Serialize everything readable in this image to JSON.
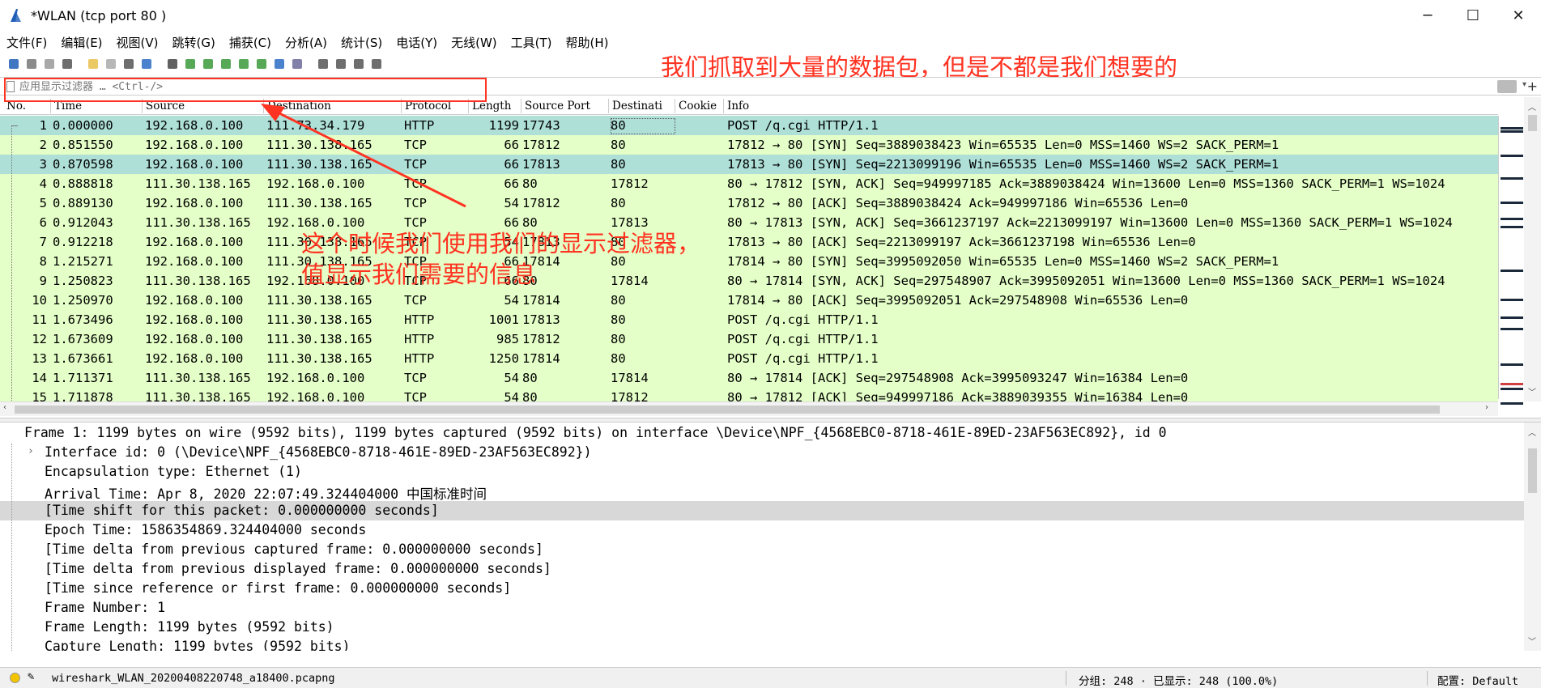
{
  "window": {
    "title": "*WLAN (tcp port 80 )",
    "minimize": "─",
    "maximize": "☐",
    "close": "✕"
  },
  "menu": [
    "文件(F)",
    "编辑(E)",
    "视图(V)",
    "跳转(G)",
    "捕获(C)",
    "分析(A)",
    "统计(S)",
    "电话(Y)",
    "无线(W)",
    "工具(T)",
    "帮助(H)"
  ],
  "toolbar_icons": [
    "shark-fin-start-icon",
    "stop-icon",
    "restart-icon",
    "capture-options-icon",
    "open-file-icon",
    "save-file-icon",
    "close-file-icon",
    "reload-icon",
    "find-packet-icon",
    "go-back-icon",
    "go-forward-icon",
    "go-to-packet-icon",
    "go-first-icon",
    "go-last-icon",
    "autoscroll-icon",
    "colorize-icon",
    "zoom-in-icon",
    "zoom-out-icon",
    "zoom-normal-icon",
    "resize-columns-icon"
  ],
  "filter": {
    "placeholder": "应用显示过滤器 … <Ctrl-/>"
  },
  "annotations": {
    "top": "我们抓取到大量的数据包，但是不都是我们想要的",
    "middle_line1": "这个时候我们使用我们的显示过滤器，",
    "middle_line2": "值显示我们需要的信息"
  },
  "columns": [
    "No.",
    "Time",
    "Source",
    "Destination",
    "Protocol",
    "Length",
    "Source Port",
    "Destinati",
    "Cookie",
    "Info"
  ],
  "packets": [
    {
      "no": "1",
      "time": "0.000000",
      "src": "192.168.0.100",
      "dst": "111.73.34.179",
      "proto": "HTTP",
      "len": "1199",
      "sport": "17743",
      "dport": "80",
      "info": "POST /q.cgi HTTP/1.1",
      "color": "#aee0d8"
    },
    {
      "no": "2",
      "time": "0.851550",
      "src": "192.168.0.100",
      "dst": "111.30.138.165",
      "proto": "TCP",
      "len": "66",
      "sport": "17812",
      "dport": "80",
      "info": "17812 → 80 [SYN] Seq=3889038423 Win=65535 Len=0 MSS=1460 WS=2 SACK_PERM=1",
      "color": "#e4ffc7"
    },
    {
      "no": "3",
      "time": "0.870598",
      "src": "192.168.0.100",
      "dst": "111.30.138.165",
      "proto": "TCP",
      "len": "66",
      "sport": "17813",
      "dport": "80",
      "info": "17813 → 80 [SYN] Seq=2213099196 Win=65535 Len=0 MSS=1460 WS=2 SACK_PERM=1",
      "color": "#aee0d8"
    },
    {
      "no": "4",
      "time": "0.888818",
      "src": "111.30.138.165",
      "dst": "192.168.0.100",
      "proto": "TCP",
      "len": "66",
      "sport": "80",
      "dport": "17812",
      "info": "80 → 17812 [SYN, ACK] Seq=949997185 Ack=3889038424 Win=13600 Len=0 MSS=1360 SACK_PERM=1 WS=1024",
      "color": "#e4ffc7"
    },
    {
      "no": "5",
      "time": "0.889130",
      "src": "192.168.0.100",
      "dst": "111.30.138.165",
      "proto": "TCP",
      "len": "54",
      "sport": "17812",
      "dport": "80",
      "info": "17812 → 80 [ACK] Seq=3889038424 Ack=949997186 Win=65536 Len=0",
      "color": "#e4ffc7"
    },
    {
      "no": "6",
      "time": "0.912043",
      "src": "111.30.138.165",
      "dst": "192.168.0.100",
      "proto": "TCP",
      "len": "66",
      "sport": "80",
      "dport": "17813",
      "info": "80 → 17813 [SYN, ACK] Seq=3661237197 Ack=2213099197 Win=13600 Len=0 MSS=1360 SACK_PERM=1 WS=1024",
      "color": "#e4ffc7"
    },
    {
      "no": "7",
      "time": "0.912218",
      "src": "192.168.0.100",
      "dst": "111.30.138.165",
      "proto": "TCP",
      "len": "54",
      "sport": "17813",
      "dport": "80",
      "info": "17813 → 80 [ACK] Seq=2213099197 Ack=3661237198 Win=65536 Len=0",
      "color": "#e4ffc7"
    },
    {
      "no": "8",
      "time": "1.215271",
      "src": "192.168.0.100",
      "dst": "111.30.138.165",
      "proto": "TCP",
      "len": "66",
      "sport": "17814",
      "dport": "80",
      "info": "17814 → 80 [SYN] Seq=3995092050 Win=65535 Len=0 MSS=1460 WS=2 SACK_PERM=1",
      "color": "#e4ffc7"
    },
    {
      "no": "9",
      "time": "1.250823",
      "src": "111.30.138.165",
      "dst": "192.168.0.100",
      "proto": "TCP",
      "len": "66",
      "sport": "80",
      "dport": "17814",
      "info": "80 → 17814 [SYN, ACK] Seq=297548907 Ack=3995092051 Win=13600 Len=0 MSS=1360 SACK_PERM=1 WS=1024",
      "color": "#e4ffc7"
    },
    {
      "no": "10",
      "time": "1.250970",
      "src": "192.168.0.100",
      "dst": "111.30.138.165",
      "proto": "TCP",
      "len": "54",
      "sport": "17814",
      "dport": "80",
      "info": "17814 → 80 [ACK] Seq=3995092051 Ack=297548908 Win=65536 Len=0",
      "color": "#e4ffc7"
    },
    {
      "no": "11",
      "time": "1.673496",
      "src": "192.168.0.100",
      "dst": "111.30.138.165",
      "proto": "HTTP",
      "len": "1001",
      "sport": "17813",
      "dport": "80",
      "info": "POST /q.cgi HTTP/1.1",
      "color": "#e4ffc7"
    },
    {
      "no": "12",
      "time": "1.673609",
      "src": "192.168.0.100",
      "dst": "111.30.138.165",
      "proto": "HTTP",
      "len": "985",
      "sport": "17812",
      "dport": "80",
      "info": "POST /q.cgi HTTP/1.1",
      "color": "#e4ffc7"
    },
    {
      "no": "13",
      "time": "1.673661",
      "src": "192.168.0.100",
      "dst": "111.30.138.165",
      "proto": "HTTP",
      "len": "1250",
      "sport": "17814",
      "dport": "80",
      "info": "POST /q.cgi HTTP/1.1",
      "color": "#e4ffc7"
    },
    {
      "no": "14",
      "time": "1.711371",
      "src": "111.30.138.165",
      "dst": "192.168.0.100",
      "proto": "TCP",
      "len": "54",
      "sport": "80",
      "dport": "17814",
      "info": "80 → 17814 [ACK] Seq=297548908 Ack=3995093247 Win=16384 Len=0",
      "color": "#e4ffc7"
    },
    {
      "no": "15",
      "time": "1.711878",
      "src": "111.30.138.165",
      "dst": "192.168.0.100",
      "proto": "TCP",
      "len": "54",
      "sport": "80",
      "dport": "17812",
      "info": "80 → 17812 [ACK] Seq=949997186 Ack=3889039355 Win=16384 Len=0",
      "color": "#e4ffc7"
    }
  ],
  "details": [
    {
      "text": "Frame 1: 1199 bytes on wire (9592 bits), 1199 bytes captured (9592 bits) on interface \\Device\\NPF_{4568EBC0-8718-461E-89ED-23AF563EC892}, id 0",
      "indent": 0,
      "arrow": "",
      "hl": false
    },
    {
      "text": "Interface id: 0 (\\Device\\NPF_{4568EBC0-8718-461E-89ED-23AF563EC892})",
      "indent": 1,
      "arrow": "›",
      "hl": false
    },
    {
      "text": "Encapsulation type: Ethernet (1)",
      "indent": 1,
      "arrow": "",
      "hl": false
    },
    {
      "text": "Arrival Time: Apr  8, 2020 22:07:49.324404000 中国标准时间",
      "indent": 1,
      "arrow": "",
      "hl": false
    },
    {
      "text": "[Time shift for this packet: 0.000000000 seconds]",
      "indent": 1,
      "arrow": "",
      "hl": true
    },
    {
      "text": "Epoch Time: 1586354869.324404000 seconds",
      "indent": 1,
      "arrow": "",
      "hl": false
    },
    {
      "text": "[Time delta from previous captured frame: 0.000000000 seconds]",
      "indent": 1,
      "arrow": "",
      "hl": false
    },
    {
      "text": "[Time delta from previous displayed frame: 0.000000000 seconds]",
      "indent": 1,
      "arrow": "",
      "hl": false
    },
    {
      "text": "[Time since reference or first frame: 0.000000000 seconds]",
      "indent": 1,
      "arrow": "",
      "hl": false
    },
    {
      "text": "Frame Number: 1",
      "indent": 1,
      "arrow": "",
      "hl": false
    },
    {
      "text": "Frame Length: 1199 bytes (9592 bits)",
      "indent": 1,
      "arrow": "",
      "hl": false
    },
    {
      "text": "Capture Length: 1199 bytes (9592 bits)",
      "indent": 1,
      "arrow": "",
      "hl": false
    }
  ],
  "status": {
    "file": "wireshark_WLAN_20200408220748_a18400.pcapng",
    "packets": "分组: 248 · 已显示: 248 (100.0%)",
    "profile": "配置: Default"
  },
  "colors": {
    "accent_red": "#ff3322",
    "row_green": "#e4ffc7",
    "row_teal": "#aee0d8"
  }
}
